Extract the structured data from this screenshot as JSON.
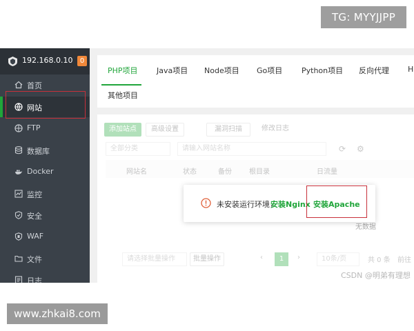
{
  "watermarks": {
    "tg": "TG: MYYJJPP",
    "site": "www.zhkai8.com",
    "csdn": "CSDN @明弟有理想"
  },
  "sidebar": {
    "server_ip": "192.168.0.10",
    "badge": "0",
    "items": [
      {
        "label": "首页",
        "icon": "home-icon"
      },
      {
        "label": "网站",
        "icon": "globe-icon",
        "active": true
      },
      {
        "label": "FTP",
        "icon": "ftp-icon"
      },
      {
        "label": "数据库",
        "icon": "database-icon"
      },
      {
        "label": "Docker",
        "icon": "docker-icon"
      },
      {
        "label": "监控",
        "icon": "monitor-icon"
      },
      {
        "label": "安全",
        "icon": "shield-icon"
      },
      {
        "label": "WAF",
        "icon": "waf-icon"
      },
      {
        "label": "文件",
        "icon": "folder-icon"
      },
      {
        "label": "日志",
        "icon": "log-icon"
      }
    ]
  },
  "tabs": {
    "items": [
      "PHP项目",
      "Java项目",
      "Node项目",
      "Go项目",
      "Python项目",
      "反向代理",
      "H"
    ],
    "row2": "其他项目",
    "active_index": 0
  },
  "toolbar": {
    "add_site": "添加站点",
    "advanced": "高级设置",
    "scan": "漏洞扫描",
    "mod_log": "修改日志"
  },
  "filters": {
    "category": "全部分类",
    "search_placeholder": "请输入网站名称"
  },
  "table": {
    "headers": [
      "网站名",
      "状态",
      "备份",
      "根目录",
      "日流量"
    ],
    "empty_text": "无数据"
  },
  "pager": {
    "batch_placeholder": "请选择批量操作",
    "batch_btn": "批量操作",
    "page": "1",
    "per_page": "10条/页",
    "total": "共 0 条",
    "goto": "前往"
  },
  "alert": {
    "message": "未安装运行环境，",
    "install_nginx": "安装Nginx",
    "install_apache": "安装Apache"
  },
  "colors": {
    "accent": "#20a53a",
    "sidebar_bg": "#3a4149",
    "highlight": "#c8303a"
  }
}
